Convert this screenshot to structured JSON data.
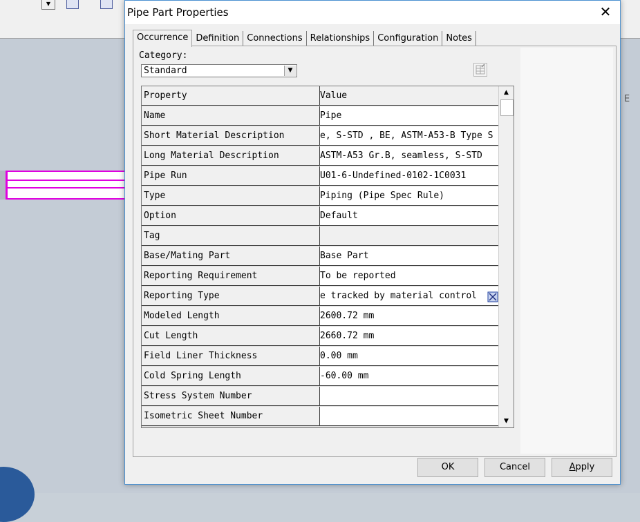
{
  "background": {
    "side_letter": "E"
  },
  "dialog": {
    "title": "Pipe Part Properties",
    "close_glyph": "✕",
    "tabs": [
      {
        "label": "Occurrence",
        "active": true
      },
      {
        "label": "Definition"
      },
      {
        "label": "Connections"
      },
      {
        "label": "Relationships"
      },
      {
        "label": "Configuration"
      },
      {
        "label": "Notes"
      }
    ],
    "category": {
      "label": "Category:",
      "value": "Standard"
    },
    "grid": {
      "header": {
        "property": "Property",
        "value": "Value"
      },
      "rows": [
        {
          "property": "Name",
          "value": "Pipe"
        },
        {
          "property": "Short Material Description",
          "value": "e, S-STD , BE, ASTM-A53-B Type S"
        },
        {
          "property": "Long Material Description",
          "value": "ASTM-A53 Gr.B, seamless, S-STD "
        },
        {
          "property": "Pipe Run",
          "value": "U01-6-Undefined-0102-1C0031"
        },
        {
          "property": "Type",
          "value": "Piping (Pipe Spec Rule)"
        },
        {
          "property": "Option",
          "value": "Default"
        },
        {
          "property": "Tag",
          "value": ""
        },
        {
          "property": "Base/Mating Part",
          "value": "Base Part"
        },
        {
          "property": "Reporting Requirement",
          "value": "To be reported"
        },
        {
          "property": "Reporting Type",
          "value": "e tracked by material control"
        },
        {
          "property": "Modeled Length",
          "value": "2600.72 mm"
        },
        {
          "property": "Cut Length",
          "value": "2660.72 mm"
        },
        {
          "property": "Field Liner Thickness",
          "value": "0.00 mm"
        },
        {
          "property": "Cold Spring Length",
          "value": "-60.00 mm"
        },
        {
          "property": "Stress System Number",
          "value": ""
        },
        {
          "property": "Isometric Sheet Number",
          "value": ""
        }
      ]
    },
    "buttons": {
      "ok": "OK",
      "cancel": "Cancel",
      "apply_first": "A",
      "apply_rest": "pply"
    }
  },
  "colors": {
    "accent_border": "#4a90d0",
    "selection_highlight": "#e000e0"
  }
}
